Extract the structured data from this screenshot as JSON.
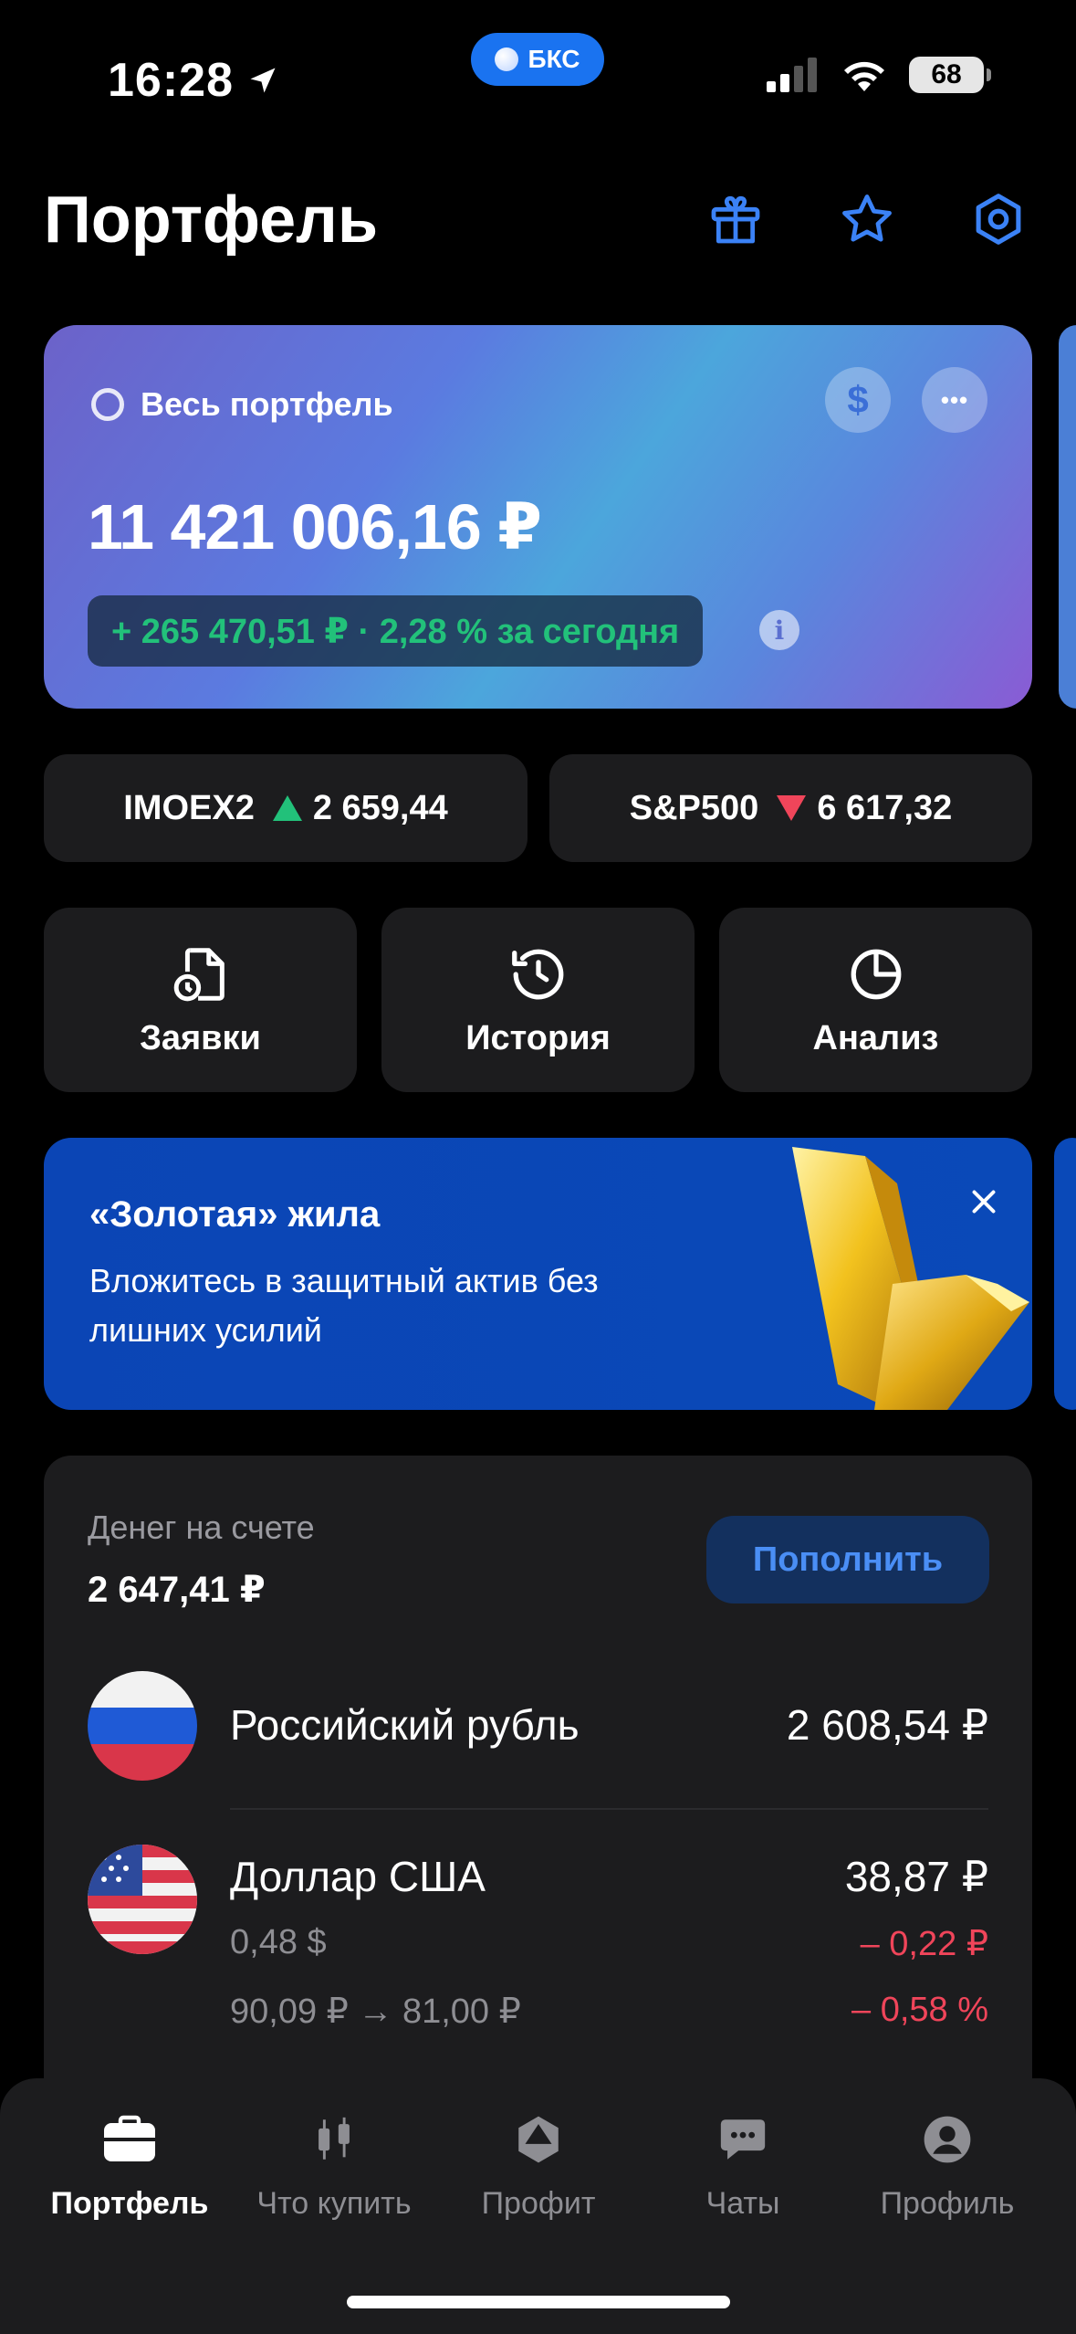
{
  "status_bar": {
    "time": "16:28",
    "carrier_badge": "БКС",
    "battery": "68"
  },
  "header": {
    "title": "Портфель",
    "icons": [
      "gift-icon",
      "star-icon",
      "settings-hex-icon"
    ]
  },
  "portfolio": {
    "label": "Весь портфель",
    "total": "11 421 006,16 ₽",
    "change": "+ 265 470,51 ₽ · 2,28 % за сегодня",
    "currency_symbol": "$",
    "more_symbol": "•••",
    "info_symbol": "i"
  },
  "indices": [
    {
      "name": "IMOEX2",
      "value": "2 659,44",
      "direction": "up"
    },
    {
      "name": "S&P500",
      "value": "6 617,32",
      "direction": "down"
    }
  ],
  "actions": [
    {
      "label": "Заявки",
      "icon": "orders-document-icon"
    },
    {
      "label": "История",
      "icon": "history-clock-icon"
    },
    {
      "label": "Анализ",
      "icon": "analysis-pie-icon"
    }
  ],
  "promo": {
    "title": "«Золотая» жила",
    "text": "Вложитесь в защитный актив без лишних усилий"
  },
  "money": {
    "label": "Денег на счете",
    "total": "2 647,41 ₽",
    "topup_label": "Пополнить",
    "currencies": [
      {
        "name": "Российский рубль",
        "value": "2 608,54 ₽"
      },
      {
        "name": "Доллар США",
        "value": "38,87 ₽",
        "amount": "0,48 $",
        "rate": "90,09 ₽ → 81,00 ₽",
        "change_abs": "– 0,22 ₽",
        "change_pct": "– 0,58 %"
      }
    ]
  },
  "tabs": [
    {
      "label": "Портфель",
      "active": true
    },
    {
      "label": "Что купить",
      "active": false
    },
    {
      "label": "Профит",
      "active": false
    },
    {
      "label": "Чаты",
      "active": false
    },
    {
      "label": "Профиль",
      "active": false
    }
  ],
  "colors": {
    "accent": "#4a8ef5",
    "positive": "#22c17a",
    "negative": "#f0455a",
    "card": "#1c1c1e"
  }
}
